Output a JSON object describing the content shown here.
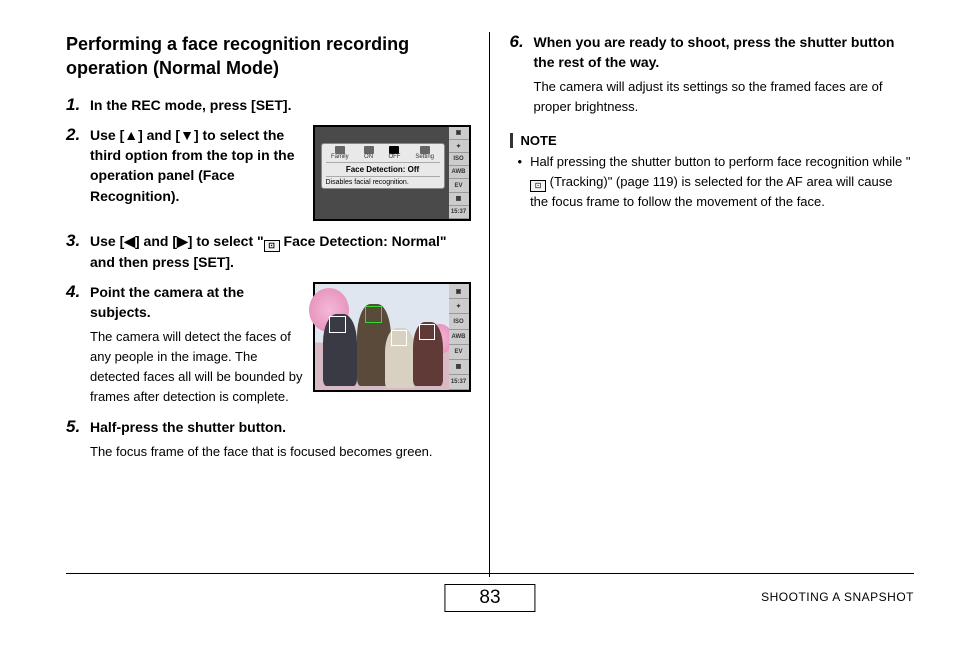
{
  "title": "Performing a face recognition recording operation (Normal Mode)",
  "steps": {
    "s1": {
      "num": "1.",
      "lead": "In the REC mode, press [SET]."
    },
    "s2": {
      "num": "2.",
      "lead": "Use [▲] and [▼] to select the third option from the top in the operation panel (Face Recognition)."
    },
    "s3": {
      "num": "3.",
      "lead_a": "Use [◀] and [▶] to select \"",
      "lead_b": " Face Detection: Normal\" and then press [SET]."
    },
    "s4": {
      "num": "4.",
      "lead": "Point the camera at the subjects.",
      "desc": "The camera will detect the faces of any people in the image. The detected faces all will be bounded by frames after detection is complete."
    },
    "s5": {
      "num": "5.",
      "lead": "Half-press the shutter button.",
      "desc": "The focus frame of the face that is focused becomes green."
    },
    "s6": {
      "num": "6.",
      "lead": "When you are ready to shoot, press the shutter button the rest of the way.",
      "desc": "The camera will adjust its settings so the framed faces are of proper brightness."
    }
  },
  "panel": {
    "title": "Face Detection: Off",
    "subtitle": "Disables facial recognition.",
    "tabs": {
      "a": "Family",
      "b": "ON",
      "c": "OFF",
      "d": "Setting"
    }
  },
  "sidebar": {
    "i1": "▣",
    "i2": "✦",
    "i3": "ISO",
    "i4": "AWB",
    "i5": "EV",
    "i6": "▦",
    "time": "15:37"
  },
  "note": {
    "label": "NOTE",
    "text_a": "Half pressing the shutter button to perform face recognition while \"",
    "text_b": " (Tracking)\" (page 119) is selected for the AF area will cause the focus frame to follow the movement of the face."
  },
  "footer": {
    "page": "83",
    "section": "SHOOTING A SNAPSHOT"
  }
}
